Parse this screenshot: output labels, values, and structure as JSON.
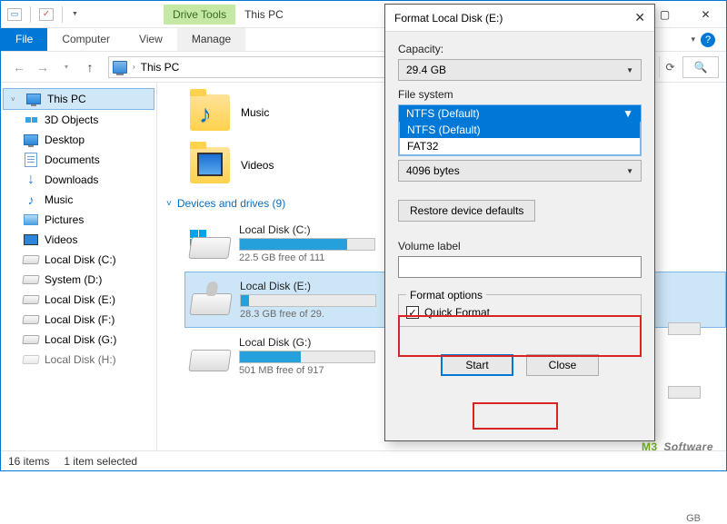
{
  "titlebar": {
    "drive_tools": "Drive Tools",
    "title": "This PC",
    "minimize": "—",
    "close": "✕"
  },
  "ribbon": {
    "file": "File",
    "computer": "Computer",
    "view": "View",
    "manage": "Manage"
  },
  "address": {
    "breadcrumb": "This PC"
  },
  "sidebar": {
    "root": "This PC",
    "items": [
      {
        "label": "3D Objects"
      },
      {
        "label": "Desktop"
      },
      {
        "label": "Documents"
      },
      {
        "label": "Downloads"
      },
      {
        "label": "Music"
      },
      {
        "label": "Pictures"
      },
      {
        "label": "Videos"
      },
      {
        "label": "Local Disk (C:)"
      },
      {
        "label": "System (D:)"
      },
      {
        "label": "Local Disk (E:)"
      },
      {
        "label": "Local Disk (F:)"
      },
      {
        "label": "Local Disk (G:)"
      },
      {
        "label": "Local Disk (H:)"
      }
    ]
  },
  "content": {
    "folders": [
      {
        "label": "Music"
      },
      {
        "label": "Videos"
      }
    ],
    "section": "Devices and drives (9)",
    "drives": [
      {
        "name": "Local Disk (C:)",
        "free": "22.5 GB free of 111",
        "fill": 80,
        "selected": false,
        "win": true
      },
      {
        "name": "Local Disk (E:)",
        "free": "28.3 GB free of 29.",
        "fill": 6,
        "selected": true,
        "win": false
      },
      {
        "name": "Local Disk (G:)",
        "free": "501 MB free of 917",
        "fill": 45,
        "selected": false,
        "win": false
      }
    ],
    "ghost_gb": "GB"
  },
  "statusbar": {
    "count": "16 items",
    "selected": "1 item selected"
  },
  "dialog": {
    "title": "Format Local Disk (E:)",
    "capacity_label": "Capacity:",
    "capacity_value": "29.4 GB",
    "filesystem_label": "File system",
    "filesystem_selected": "NTFS (Default)",
    "filesystem_options": [
      "NTFS (Default)",
      "FAT32"
    ],
    "alloc_value": "4096 bytes",
    "restore": "Restore device defaults",
    "volume_label": "Volume label",
    "volume_value": "",
    "format_options": "Format options",
    "quick_format": "Quick Format",
    "start": "Start",
    "close": "Close"
  },
  "watermark": {
    "m3": "M3",
    "rest": "Software"
  }
}
